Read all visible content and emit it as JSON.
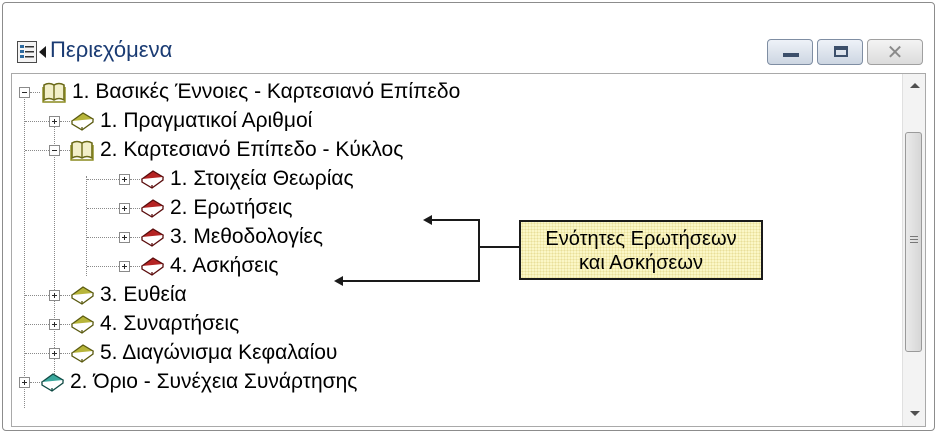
{
  "window": {
    "title": "Περιεχόμενα",
    "close_glyph": "✕"
  },
  "tree": {
    "items": [
      {
        "label": "1.  Βασικές Έννοιες - Καρτεσιανό Επίπεδο",
        "icon": "book-open-icon",
        "expanded": true,
        "level": 0
      },
      {
        "label": "1.  Πραγματικοί Αριθμοί",
        "icon": "book-olive-icon",
        "expanded": false,
        "level": 1
      },
      {
        "label": "2.  Καρτεσιανό Επίπεδο - Κύκλος",
        "icon": "book-open-icon",
        "expanded": true,
        "level": 1
      },
      {
        "label": "1.  Στοιχεία Θεωρίας",
        "icon": "book-red-icon",
        "expanded": false,
        "level": 2
      },
      {
        "label": "2.  Ερωτήσεις",
        "icon": "book-red-icon",
        "expanded": false,
        "level": 2
      },
      {
        "label": "3.  Μεθοδολογίες",
        "icon": "book-red-icon",
        "expanded": false,
        "level": 2
      },
      {
        "label": "4.  Ασκήσεις",
        "icon": "book-red-icon",
        "expanded": false,
        "level": 2
      },
      {
        "label": "3.  Ευθεία",
        "icon": "book-olive-icon",
        "expanded": false,
        "level": 1
      },
      {
        "label": "4.  Συναρτήσεις",
        "icon": "book-olive-icon",
        "expanded": false,
        "level": 1
      },
      {
        "label": "5.  Διαγώνισμα Κεφαλαίου",
        "icon": "book-olive-icon",
        "expanded": false,
        "level": 1
      },
      {
        "label": "2.  Όριο - Συνέχεια Συνάρτησης",
        "icon": "book-teal-icon",
        "expanded": false,
        "level": 0
      }
    ]
  },
  "callout": {
    "line1": "Ενότητες Ερωτήσεων",
    "line2": "και Ασκήσεων"
  },
  "colors": {
    "olive": "#8a8a1f",
    "red": "#9b1b1b",
    "teal": "#2b8f86",
    "title": "#1a3b73",
    "callout_bg": "#fbf7c6"
  }
}
